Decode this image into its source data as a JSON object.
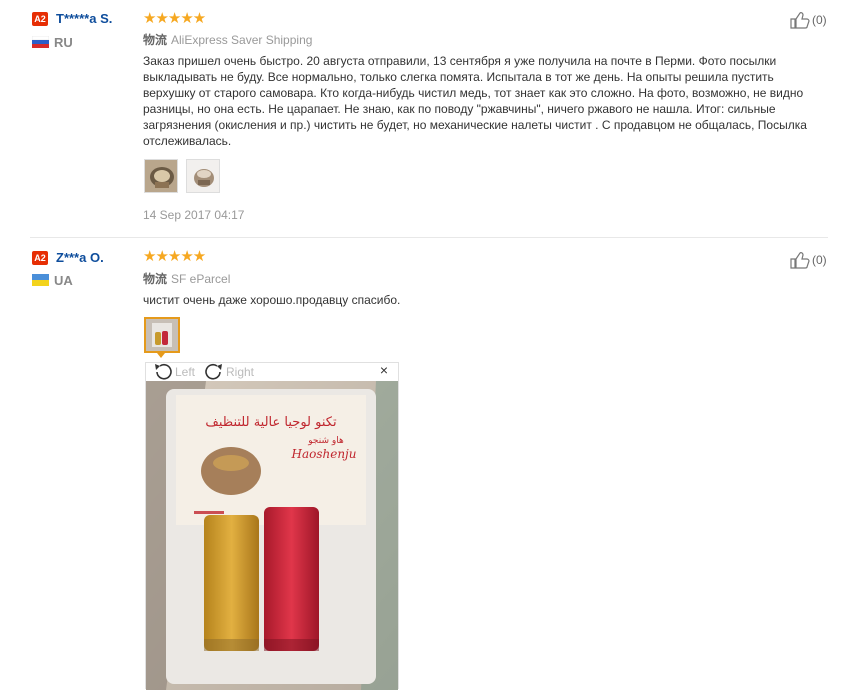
{
  "reviews": [
    {
      "badge": "A2",
      "name": "T*****a S.",
      "country": "RU",
      "stars": "★★★★★",
      "ship_prefix": "物流",
      "shipping": "AliExpress Saver Shipping",
      "text": "Заказ пришел очень быстро. 20 августа отправили, 13 сентября я уже получила на почте в Перми. Фото посылки выкладывать не буду. Все нормально, только слегка помята. Испытала в тот же день. На опыты решила пустить верхушку от старого самовара. Кто когда-нибудь чистил медь, тот знает как это сложно. На фото, возможно, не видно разницы, но она есть. Не царапает. Не знаю, как по поводу \"ржавчины\", ничего ржавого не нашла. Итог: сильные загрязнения (окисления и пр.) чистить не будет, но механические налеты чистит . С продавцом не общалась, Посылка отслеживалась.",
      "date": "14 Sep 2017 04:17",
      "helpful": "(0)"
    },
    {
      "badge": "A2",
      "name": "Z***a O.",
      "country": "UA",
      "stars": "★★★★★",
      "ship_prefix": "物流",
      "shipping": "SF eParcel",
      "text": "чистит очень даже хорошо.продавцу спасибо.",
      "helpful": "(0)"
    }
  ],
  "viewer": {
    "left_label": "Left",
    "right_label": "Right",
    "close": "×",
    "package_arabic": "تكنو لوجيا عالية للتنظيف",
    "package_brand": "Haoshenju",
    "package_small": "هاو شنجو"
  },
  "colors": {
    "username": "#0e4d9c",
    "stars": "#f6a821",
    "badge": "#e62e04",
    "active_thumb": "#e59a1b"
  }
}
